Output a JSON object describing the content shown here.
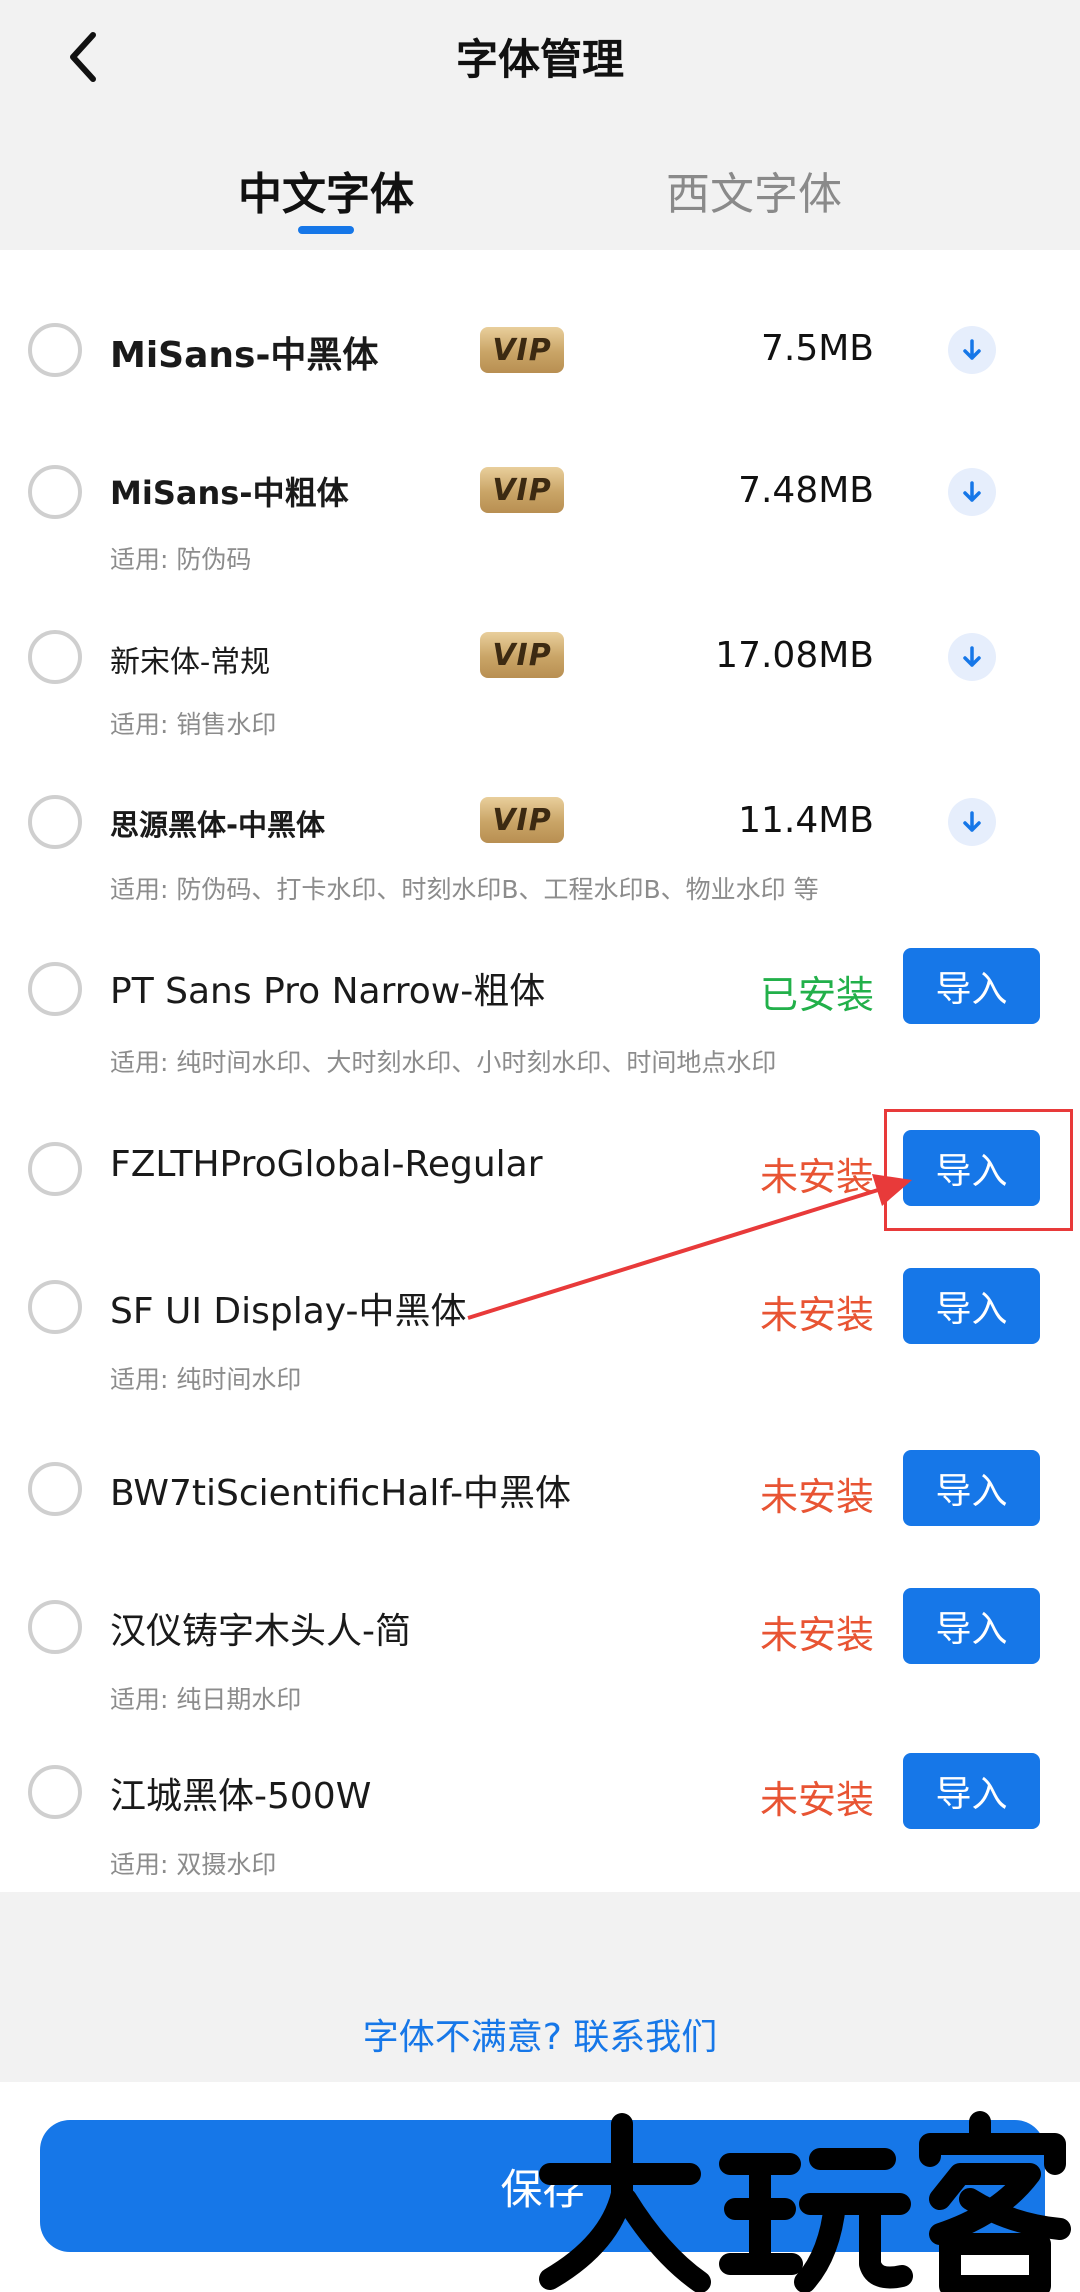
{
  "header": {
    "title": "字体管理",
    "back_icon": "chevron-left-icon",
    "tabs": [
      {
        "label": "中文字体",
        "active": true
      },
      {
        "label": "西文字体",
        "active": false
      }
    ]
  },
  "vip_label": "VIP",
  "fonts": [
    {
      "name": "MiSans-中黑体",
      "vip": true,
      "size": "7.5MB",
      "action": "download"
    },
    {
      "name": "MiSans-中粗体",
      "vip": true,
      "size": "7.48MB",
      "action": "download",
      "usage": "适用: 防伪码"
    },
    {
      "name": "新宋体-常规",
      "vip": true,
      "size": "17.08MB",
      "action": "download",
      "usage": "适用: 销售水印"
    },
    {
      "name": "思源黑体-中黑体",
      "vip": true,
      "size": "11.4MB",
      "action": "download",
      "usage": "适用: 防伪码、打卡水印、时刻水印B、工程水印B、物业水印 等"
    },
    {
      "name": "PT Sans Pro Narrow-粗体",
      "status": "已安装",
      "installed": true,
      "action": "import",
      "usage": "适用: 纯时间水印、大时刻水印、小时刻水印、时间地点水印"
    },
    {
      "name": "FZLTHProGlobal-Regular",
      "status": "未安装",
      "installed": false,
      "action": "import"
    },
    {
      "name": "SF UI Display-中黑体",
      "status": "未安装",
      "installed": false,
      "action": "import",
      "usage": "适用: 纯时间水印"
    },
    {
      "name": "BW7tiScientificHalf-中黑体",
      "status": "未安装",
      "installed": false,
      "action": "import"
    },
    {
      "name": "汉仪铸字木头人-简",
      "status": "未安装",
      "installed": false,
      "action": "import",
      "usage": "适用: 纯日期水印"
    },
    {
      "name": "江城黑体-500W",
      "status": "未安装",
      "installed": false,
      "action": "import",
      "usage": "适用: 双摄水印"
    }
  ],
  "import_label": "导入",
  "contact_link": "字体不满意? 联系我们",
  "save_label": "保存",
  "watermark_text": "大玩客",
  "colors": {
    "accent": "#1677e8",
    "installed": "#22b04a",
    "not_installed": "#e85433",
    "annotation": "#e83a3a"
  }
}
